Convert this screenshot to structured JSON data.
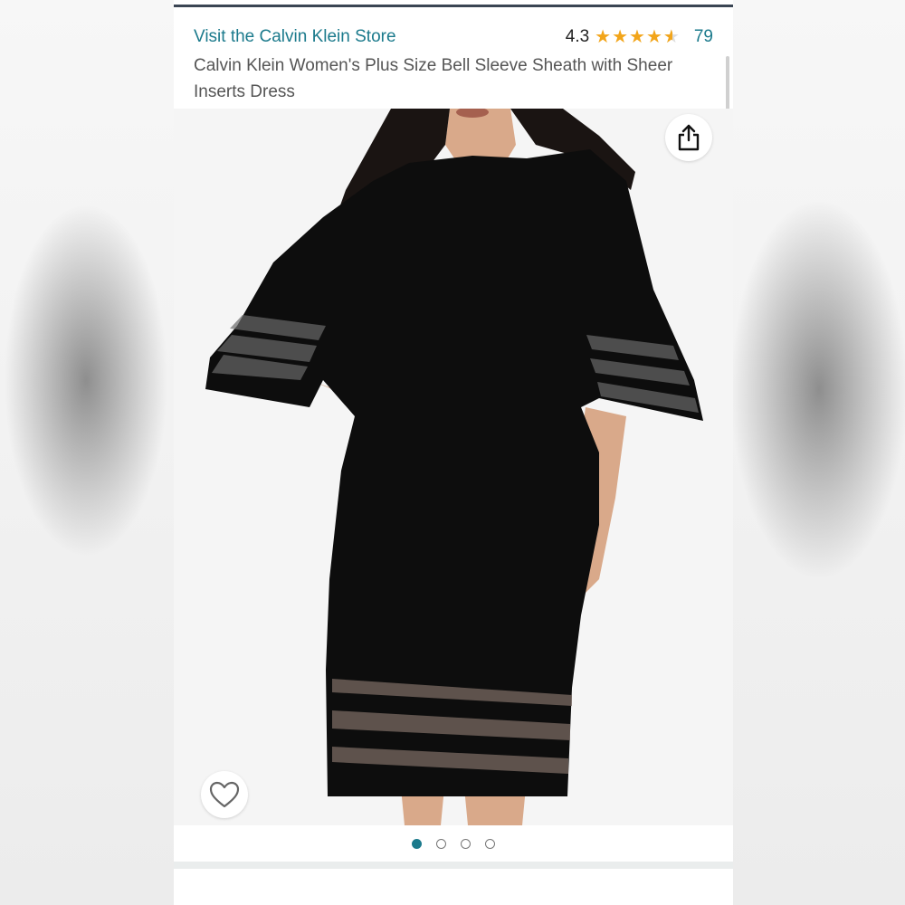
{
  "header": {
    "store_link": "Visit the Calvin Klein Store",
    "rating_value": "4.3",
    "rating_stars": 4.3,
    "review_count": "79",
    "product_title": "Calvin Klein Women's Plus Size Bell Sleeve Sheath with Sheer Inserts Dress"
  },
  "gallery": {
    "image_count": 4,
    "active_index": 0
  },
  "icons": {
    "share": "share-icon",
    "wishlist": "heart-icon",
    "star": "star-icon"
  },
  "colors": {
    "link": "#1b7a8c",
    "star": "#f2a51a",
    "dress": "#0d0d0d",
    "top_rule": "#3a4553"
  }
}
